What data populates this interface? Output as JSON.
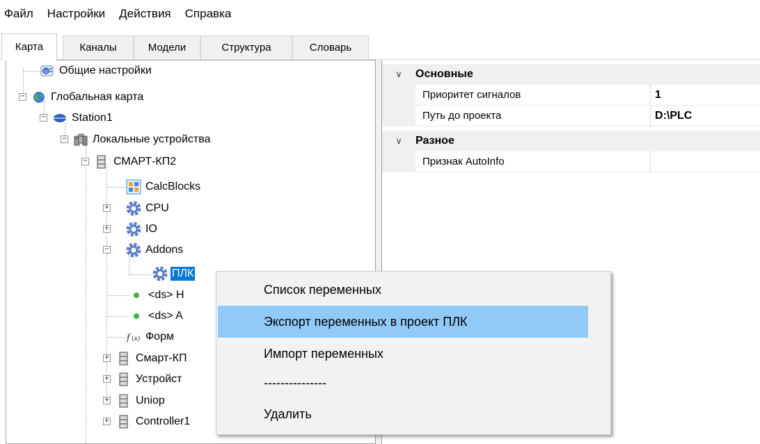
{
  "menubar": {
    "items": [
      "Файл",
      "Настройки",
      "Действия",
      "Справка"
    ]
  },
  "tabs": [
    {
      "label": "Карта",
      "active": true
    },
    {
      "label": "Каналы",
      "active": false
    },
    {
      "label": "Модели",
      "active": false
    },
    {
      "label": "Структура",
      "active": false
    },
    {
      "label": "Словарь",
      "active": false
    }
  ],
  "tree": {
    "nodes": [
      {
        "label": "Общие настройки",
        "icon": "settings-globe-icon"
      },
      {
        "label": "Глобальная карта",
        "icon": "globe-icon"
      },
      {
        "label": "Station1",
        "icon": "station-disc-icon"
      },
      {
        "label": "Локальные устройства",
        "icon": "devices-icon"
      },
      {
        "label": "СМАРТ-КП2",
        "icon": "server-icon"
      },
      {
        "label": "CalcBlocks",
        "icon": "calcblocks-icon"
      },
      {
        "label": "CPU",
        "icon": "gear-icon"
      },
      {
        "label": "IO",
        "icon": "gear-icon"
      },
      {
        "label": "Addons",
        "icon": "gear-icon"
      },
      {
        "label": "ПЛК",
        "icon": "gear-icon",
        "selected": true
      },
      {
        "label": "<ds> H",
        "icon": "green-dot-icon"
      },
      {
        "label": "<ds> A",
        "icon": "green-dot-icon"
      },
      {
        "label": "Форм",
        "icon": "formula-icon"
      },
      {
        "label": "Смарт-КП",
        "icon": "server-icon"
      },
      {
        "label": "Устройст",
        "icon": "server-icon"
      },
      {
        "label": "Uniop",
        "icon": "server-icon"
      },
      {
        "label": "Controller1",
        "icon": "server-icon"
      }
    ]
  },
  "properties": {
    "categories": [
      {
        "name": "Основные",
        "rows": [
          {
            "name": "Приоритет сигналов",
            "value": "1"
          },
          {
            "name": "Путь до проекта",
            "value": "D:\\PLC"
          }
        ]
      },
      {
        "name": "Разное",
        "rows": [
          {
            "name": "Признак AutoInfo",
            "value": ""
          }
        ]
      }
    ]
  },
  "context_menu": {
    "items": [
      {
        "label": "Список переменных"
      },
      {
        "label": "Экспорт переменных в проект ПЛК",
        "highlighted": true
      },
      {
        "label": "Импорт переменных"
      },
      {
        "label": "---------------"
      },
      {
        "label": "Удалить"
      }
    ]
  },
  "colors": {
    "selection": "#0078d7",
    "menu_highlight": "#91c9f7",
    "gear": "#5b7fc7",
    "green_dot": "#3fb53f"
  }
}
